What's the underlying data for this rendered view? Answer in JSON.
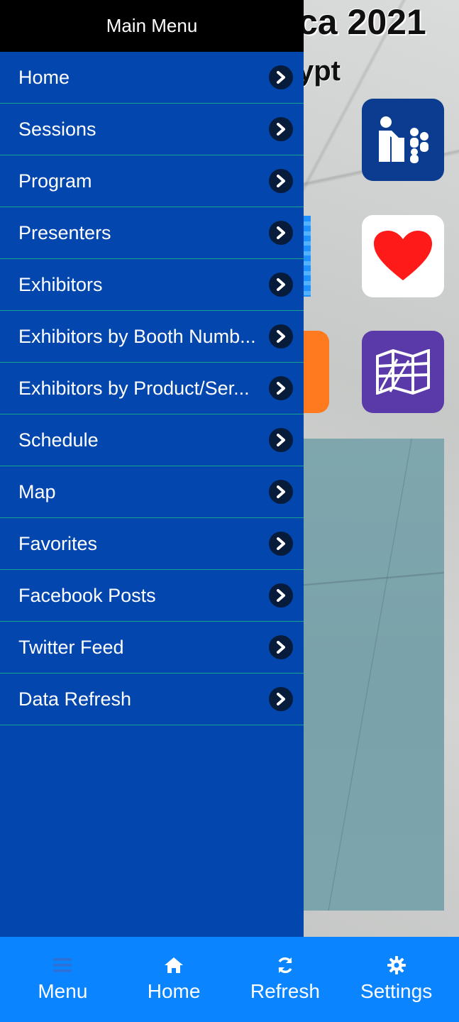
{
  "background": {
    "title_fragment": "ca 2021",
    "subtitle_fragment": "ypt",
    "tiles": [
      {
        "icon": "presenter-icon",
        "color": "#0b3c8f"
      },
      {
        "icon": "heart-icon",
        "color": "#ff1a1a"
      },
      {
        "icon": "map-icon",
        "color": "#5a3aa8"
      }
    ]
  },
  "drawer": {
    "title": "Main Menu",
    "items": [
      {
        "label": "Home"
      },
      {
        "label": "Sessions"
      },
      {
        "label": "Program"
      },
      {
        "label": "Presenters"
      },
      {
        "label": "Exhibitors"
      },
      {
        "label": "Exhibitors by Booth Numb..."
      },
      {
        "label": "Exhibitors by Product/Ser..."
      },
      {
        "label": "Schedule"
      },
      {
        "label": "Map"
      },
      {
        "label": "Favorites"
      },
      {
        "label": "Facebook Posts"
      },
      {
        "label": "Twitter Feed"
      },
      {
        "label": "Data Refresh"
      }
    ]
  },
  "tabbar": {
    "tabs": [
      {
        "label": "Menu",
        "icon": "hamburger-icon"
      },
      {
        "label": "Home",
        "icon": "home-icon"
      },
      {
        "label": "Refresh",
        "icon": "refresh-icon"
      },
      {
        "label": "Settings",
        "icon": "gear-icon"
      }
    ]
  },
  "colors": {
    "drawer_bg": "#0346ae",
    "drawer_header_bg": "#000000",
    "tabbar_bg": "#0a84ff",
    "divider": "#1aa38c"
  }
}
